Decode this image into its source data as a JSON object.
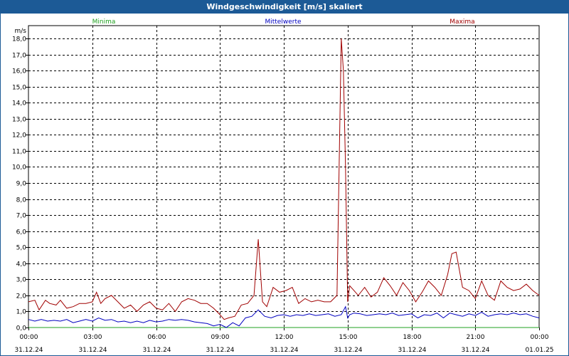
{
  "window": {
    "title": "Windgeschwindigkeit [m/s] skaliert"
  },
  "colors": {
    "minima": "#20a020",
    "mittelwerte": "#0000c0",
    "maxima": "#a00000",
    "titlebar": "#1c5a96"
  },
  "chart_data": {
    "type": "line",
    "title": "Windgeschwindigkeit [m/s] skaliert",
    "ylabel": "m/s",
    "ylim": [
      0,
      18.8
    ],
    "xlim_hours": [
      0,
      24
    ],
    "yticks": [
      "0,0",
      "1,0",
      "2,0",
      "3,0",
      "4,0",
      "5,0",
      "6,0",
      "7,0",
      "8,0",
      "9,0",
      "10,0",
      "11,0",
      "12,0",
      "13,0",
      "14,0",
      "15,0",
      "16,0",
      "17,0",
      "18,0"
    ],
    "xticks": [
      {
        "time": "00:00",
        "date": "31.12.24"
      },
      {
        "time": "03:00",
        "date": "31.12.24"
      },
      {
        "time": "06:00",
        "date": "31.12.24"
      },
      {
        "time": "09:00",
        "date": "31.12.24"
      },
      {
        "time": "12:00",
        "date": "31.12.24"
      },
      {
        "time": "15:00",
        "date": "31.12.24"
      },
      {
        "time": "18:00",
        "date": "31.12.24"
      },
      {
        "time": "21:00",
        "date": "31.12.24"
      },
      {
        "time": "00:00",
        "date": "01.01.25"
      }
    ],
    "grid": true,
    "series": [
      {
        "name": "Minima",
        "color": "#20a020",
        "x": [
          0,
          24
        ],
        "y": [
          0.0,
          0.0
        ]
      },
      {
        "name": "Mittelwerte",
        "color": "#0000c0",
        "x": [
          0,
          0.3,
          0.6,
          0.9,
          1.2,
          1.5,
          1.8,
          2.1,
          2.4,
          2.7,
          3.0,
          3.3,
          3.6,
          3.9,
          4.2,
          4.5,
          4.8,
          5.1,
          5.4,
          5.7,
          6.0,
          6.3,
          6.6,
          6.9,
          7.2,
          7.5,
          7.8,
          8.1,
          8.4,
          8.7,
          9.0,
          9.3,
          9.6,
          9.9,
          10.2,
          10.5,
          10.8,
          11.1,
          11.4,
          11.7,
          12.0,
          12.3,
          12.6,
          12.9,
          13.2,
          13.5,
          13.8,
          14.1,
          14.4,
          14.7,
          14.9,
          15.0,
          15.1,
          15.3,
          15.6,
          15.9,
          16.2,
          16.5,
          16.8,
          17.1,
          17.4,
          17.7,
          18.0,
          18.3,
          18.6,
          18.9,
          19.2,
          19.5,
          19.8,
          20.1,
          20.4,
          20.7,
          21.0,
          21.3,
          21.6,
          21.9,
          22.2,
          22.5,
          22.8,
          23.1,
          23.4,
          23.7,
          24.0
        ],
        "y": [
          0.5,
          0.4,
          0.5,
          0.4,
          0.45,
          0.4,
          0.5,
          0.3,
          0.4,
          0.5,
          0.4,
          0.6,
          0.45,
          0.5,
          0.35,
          0.4,
          0.3,
          0.4,
          0.3,
          0.45,
          0.35,
          0.4,
          0.5,
          0.45,
          0.5,
          0.45,
          0.35,
          0.3,
          0.25,
          0.1,
          0.2,
          0.0,
          0.3,
          0.1,
          0.6,
          0.7,
          1.1,
          0.7,
          0.6,
          0.75,
          0.8,
          0.7,
          0.8,
          0.75,
          0.85,
          0.75,
          0.8,
          0.85,
          0.7,
          0.8,
          1.3,
          0.6,
          0.8,
          0.9,
          0.85,
          0.75,
          0.8,
          0.85,
          0.8,
          0.9,
          0.75,
          0.8,
          0.85,
          0.6,
          0.8,
          0.75,
          0.9,
          0.6,
          0.9,
          0.8,
          0.7,
          0.85,
          0.75,
          0.95,
          0.7,
          0.8,
          0.85,
          0.8,
          0.9,
          0.8,
          0.85,
          0.7,
          0.6
        ]
      },
      {
        "name": "Maxima",
        "color": "#a00000",
        "x": [
          0,
          0.3,
          0.5,
          0.8,
          1.0,
          1.3,
          1.5,
          1.8,
          2.1,
          2.4,
          2.7,
          3.0,
          3.2,
          3.4,
          3.6,
          3.9,
          4.2,
          4.5,
          4.8,
          5.1,
          5.4,
          5.7,
          6.0,
          6.3,
          6.6,
          6.9,
          7.2,
          7.5,
          7.8,
          8.1,
          8.4,
          8.7,
          9.0,
          9.2,
          9.4,
          9.7,
          10.0,
          10.3,
          10.6,
          10.8,
          11.0,
          11.2,
          11.5,
          11.8,
          12.1,
          12.4,
          12.7,
          13.0,
          13.3,
          13.6,
          13.9,
          14.2,
          14.5,
          14.7,
          14.8,
          14.9,
          15.0,
          15.1,
          15.3,
          15.5,
          15.8,
          16.1,
          16.4,
          16.7,
          17.0,
          17.3,
          17.6,
          17.9,
          18.2,
          18.5,
          18.8,
          19.1,
          19.4,
          19.7,
          19.9,
          20.1,
          20.4,
          20.7,
          21.0,
          21.3,
          21.6,
          21.9,
          22.2,
          22.5,
          22.8,
          23.1,
          23.4,
          23.7,
          24.0
        ],
        "y": [
          1.6,
          1.7,
          1.1,
          1.7,
          1.5,
          1.4,
          1.7,
          1.2,
          1.3,
          1.5,
          1.5,
          1.6,
          2.2,
          1.5,
          1.8,
          2.0,
          1.6,
          1.2,
          1.4,
          1.0,
          1.4,
          1.6,
          1.2,
          1.1,
          1.5,
          1.0,
          1.6,
          1.8,
          1.7,
          1.5,
          1.5,
          1.2,
          0.8,
          0.5,
          0.6,
          0.7,
          1.4,
          1.5,
          2.0,
          5.5,
          1.6,
          1.3,
          2.5,
          2.2,
          2.3,
          2.5,
          1.5,
          1.8,
          1.6,
          1.7,
          1.6,
          1.6,
          2.0,
          18.0,
          16.0,
          10.0,
          1.6,
          2.6,
          2.3,
          2.0,
          2.5,
          1.9,
          2.2,
          3.1,
          2.6,
          2.0,
          2.8,
          2.3,
          1.6,
          2.2,
          2.9,
          2.5,
          2.0,
          3.3,
          4.6,
          4.7,
          2.5,
          2.3,
          1.8,
          2.9,
          2.0,
          1.7,
          2.9,
          2.5,
          2.3,
          2.4,
          2.7,
          2.3,
          2.0
        ]
      }
    ]
  }
}
